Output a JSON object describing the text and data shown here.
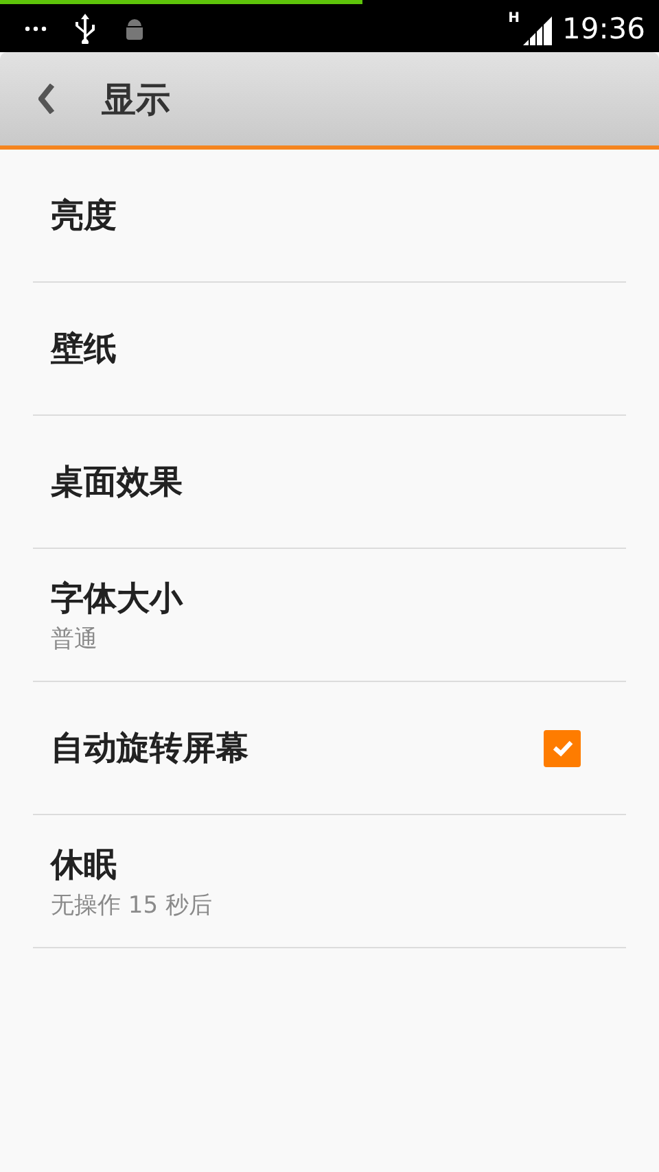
{
  "status_bar": {
    "progress": {
      "level": 0.55
    },
    "network": "H",
    "time": "19:36"
  },
  "header": {
    "title": "显示"
  },
  "items": [
    {
      "kind": "plain",
      "title": "亮度"
    },
    {
      "kind": "plain",
      "title": "壁纸"
    },
    {
      "kind": "plain",
      "title": "桌面效果"
    },
    {
      "kind": "plain",
      "title": "字体大小",
      "summary": "普通"
    },
    {
      "kind": "checkbox",
      "title": "自动旋转屏幕",
      "checked": true
    },
    {
      "kind": "plain",
      "title": "休眠",
      "summary": "无操作 15 秒后"
    }
  ]
}
